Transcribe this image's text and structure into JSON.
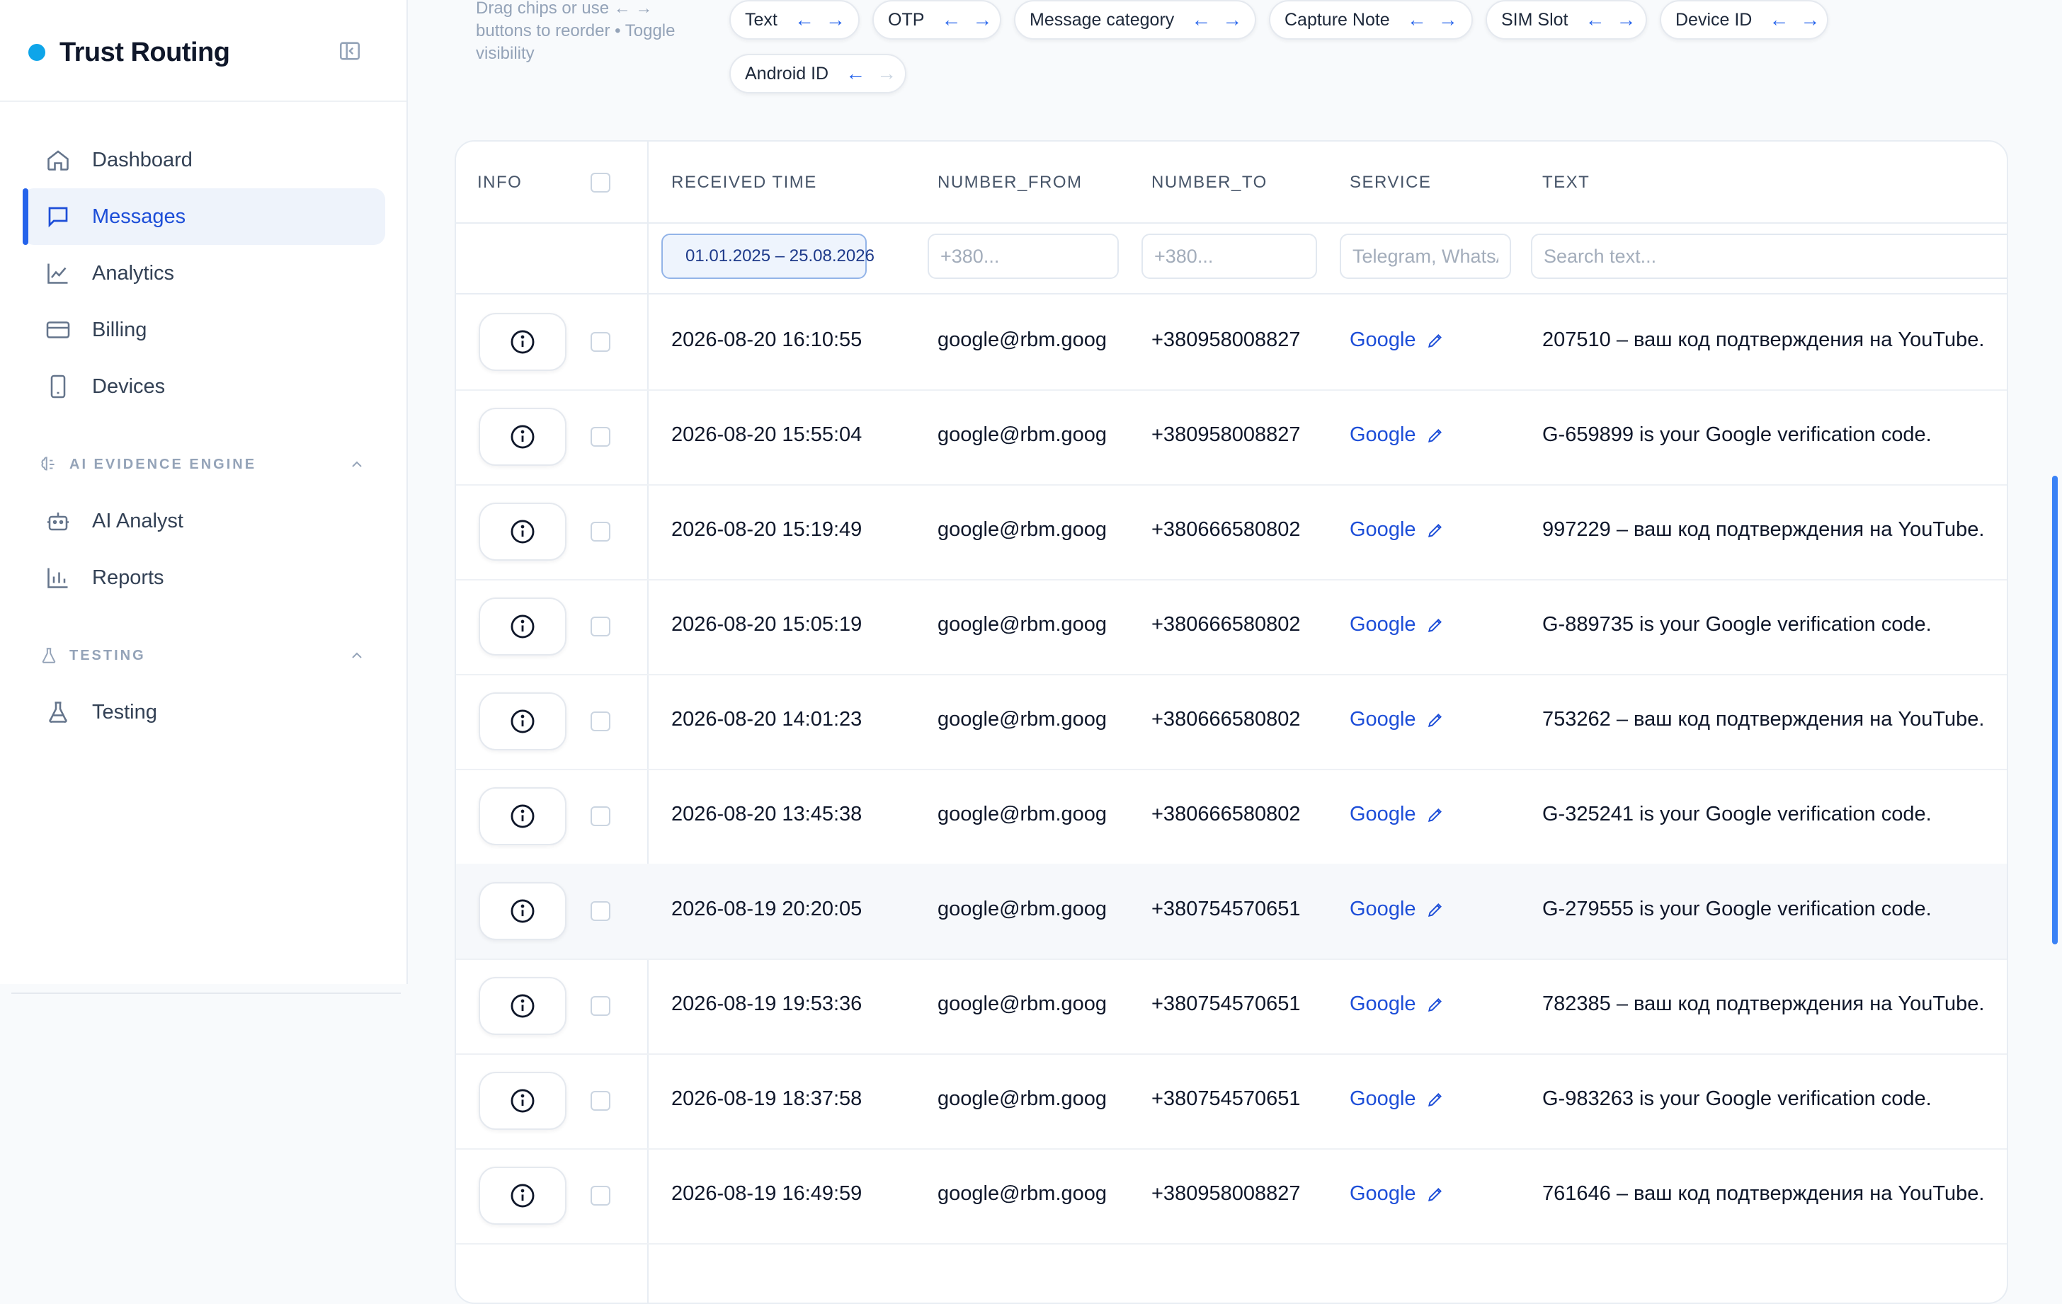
{
  "brand": {
    "name": "Trust Routing",
    "dot_color": "#0ea5e9"
  },
  "sidebar": {
    "items": [
      {
        "label": "Dashboard",
        "icon": "home-icon"
      },
      {
        "label": "Messages",
        "icon": "message-icon",
        "active": true
      },
      {
        "label": "Analytics",
        "icon": "chart-line-icon"
      },
      {
        "label": "Billing",
        "icon": "credit-card-icon"
      },
      {
        "label": "Devices",
        "icon": "phone-icon"
      }
    ],
    "ai_section": {
      "title": "AI EVIDENCE ENGINE",
      "items": [
        {
          "label": "AI Analyst",
          "icon": "robot-icon"
        },
        {
          "label": "Reports",
          "icon": "bar-chart-icon"
        }
      ]
    },
    "testing_section": {
      "title": "TESTING",
      "items": [
        {
          "label": "Testing",
          "icon": "flask-icon"
        }
      ]
    }
  },
  "chips": {
    "hint": "Drag chips or use ← → buttons to reorder • Toggle visibility",
    "items": [
      "Text",
      "OTP",
      "Message category",
      "Capture Note",
      "SIM Slot",
      "Device ID",
      "Android ID"
    ]
  },
  "table": {
    "columns": {
      "info": "INFO",
      "received": "RECEIVED TIME",
      "from": "NUMBER_FROM",
      "to": "NUMBER_TO",
      "service": "SERVICE",
      "text": "TEXT"
    },
    "filters": {
      "date_range": "01.01.2025 – 25.08.2026",
      "from_placeholder": "+380...",
      "to_placeholder": "+380...",
      "service_placeholder": "Telegram, WhatsApp",
      "text_placeholder": "Search text..."
    },
    "rows": [
      {
        "time": "2026-08-20 16:10:55",
        "from": "google@rbm.goog",
        "to": "+380958008827",
        "service": "Google",
        "text": "207510 – ваш код подтверждения на YouTube."
      },
      {
        "time": "2026-08-20 15:55:04",
        "from": "google@rbm.goog",
        "to": "+380958008827",
        "service": "Google",
        "text": "G-659899 is your Google verification code."
      },
      {
        "time": "2026-08-20 15:19:49",
        "from": "google@rbm.goog",
        "to": "+380666580802",
        "service": "Google",
        "text": "997229 – ваш код подтверждения на YouTube."
      },
      {
        "time": "2026-08-20 15:05:19",
        "from": "google@rbm.goog",
        "to": "+380666580802",
        "service": "Google",
        "text": "G-889735 is your Google verification code."
      },
      {
        "time": "2026-08-20 14:01:23",
        "from": "google@rbm.goog",
        "to": "+380666580802",
        "service": "Google",
        "text": "753262 – ваш код подтверждения на YouTube."
      },
      {
        "time": "2026-08-20 13:45:38",
        "from": "google@rbm.goog",
        "to": "+380666580802",
        "service": "Google",
        "text": "G-325241 is your Google verification code."
      },
      {
        "time": "2026-08-19 20:20:05",
        "from": "google@rbm.goog",
        "to": "+380754570651",
        "service": "Google",
        "text": "G-279555 is your Google verification code.",
        "highlighted": true
      },
      {
        "time": "2026-08-19 19:53:36",
        "from": "google@rbm.goog",
        "to": "+380754570651",
        "service": "Google",
        "text": "782385 – ваш код подтверждения на YouTube."
      },
      {
        "time": "2026-08-19 18:37:58",
        "from": "google@rbm.goog",
        "to": "+380754570651",
        "service": "Google",
        "text": "G-983263 is your Google verification code."
      },
      {
        "time": "2026-08-19 16:49:59",
        "from": "google@rbm.goog",
        "to": "+380958008827",
        "service": "Google",
        "text": "761646 – ваш код подтверждения на YouTube."
      }
    ]
  },
  "colors": {
    "accent": "#2563eb",
    "link": "#1d4ed8",
    "active_bg": "#eef3fb"
  }
}
